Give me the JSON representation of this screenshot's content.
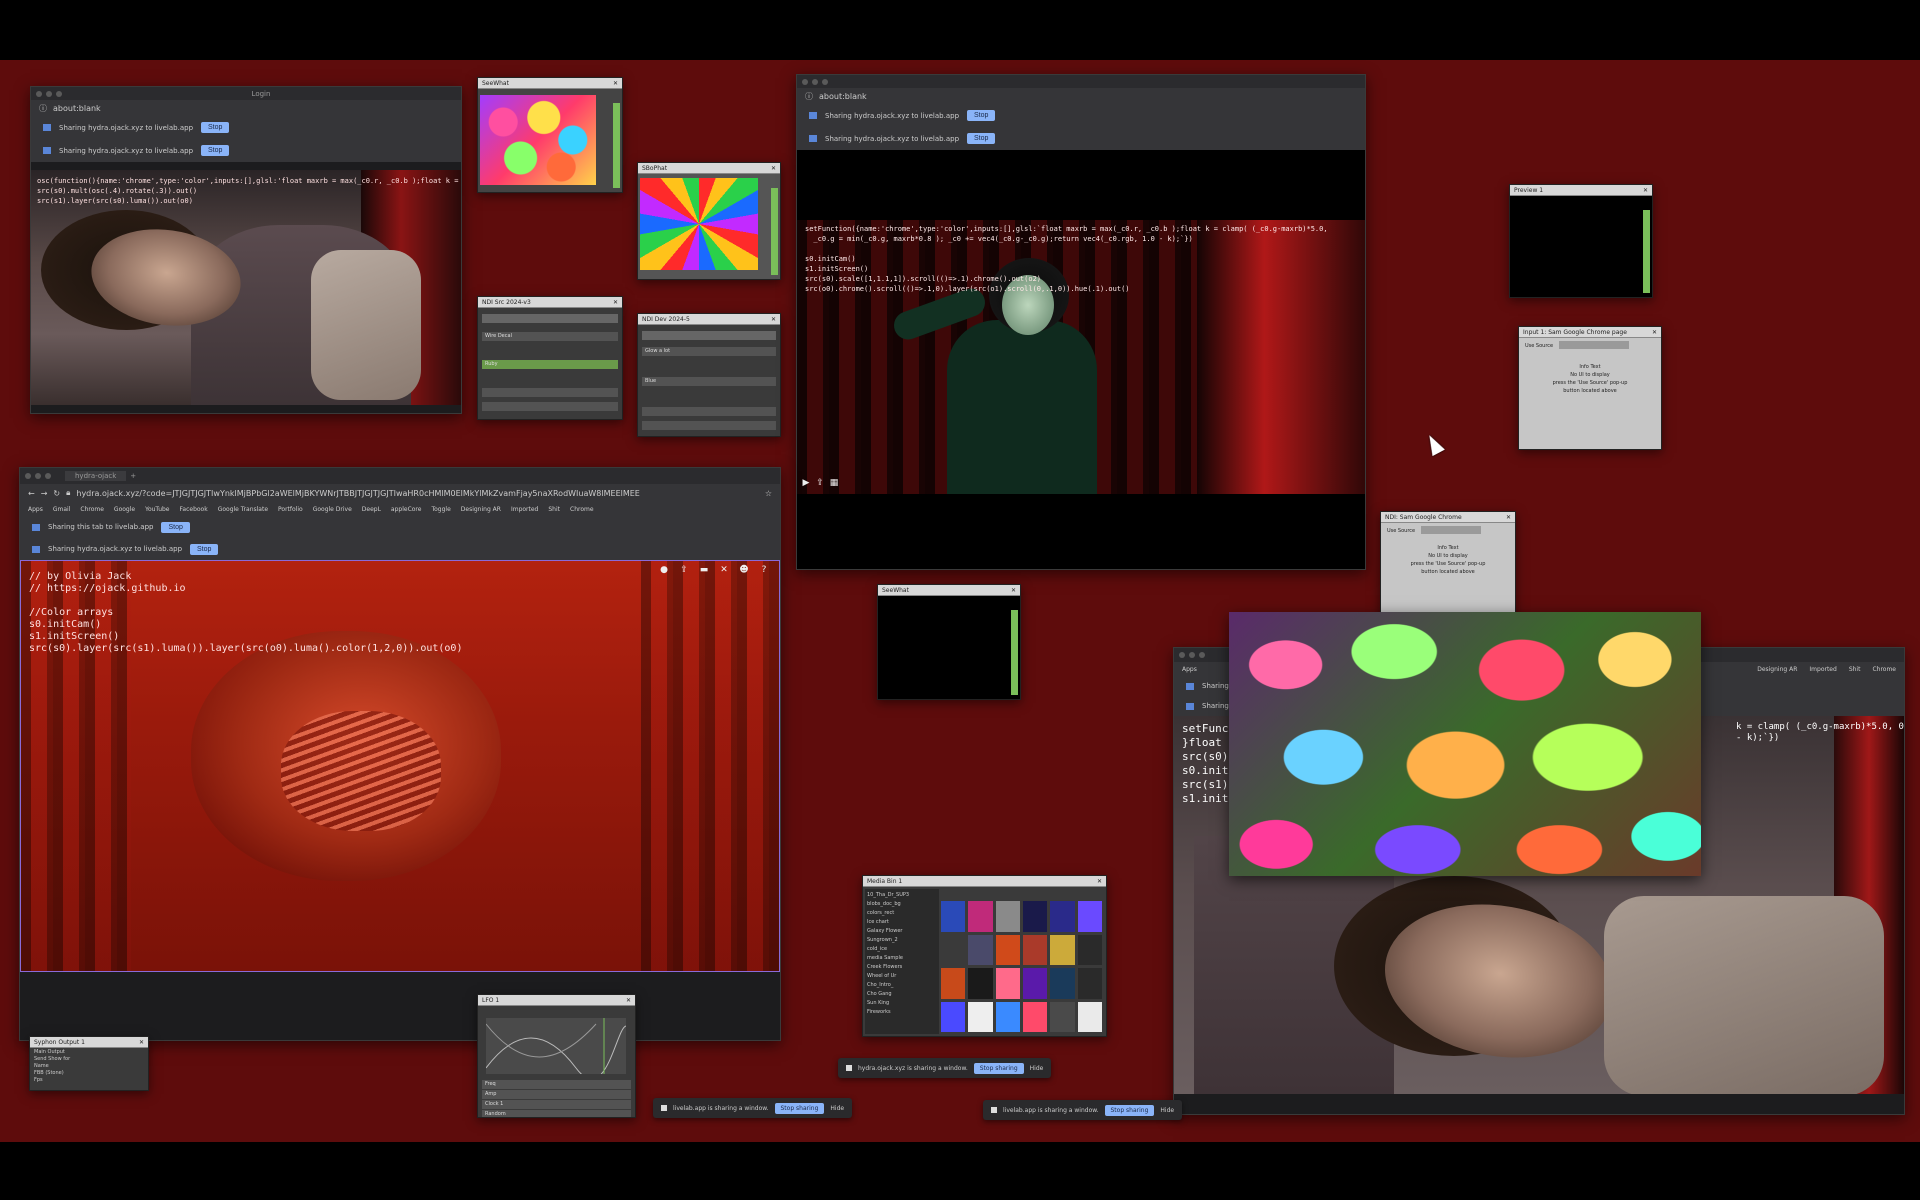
{
  "browser1": {
    "title": "Login",
    "url": "about:blank",
    "shares": [
      {
        "text": "Sharing hydra.ojack.xyz to livelab.app",
        "btn": "Stop"
      },
      {
        "text": "Sharing hydra.ojack.xyz to livelab.app",
        "btn": "Stop"
      }
    ],
    "code": "osc(function(){name:'chrome',type:'color',inputs:[],glsl:'float maxrb = max(_c0.r, _c0.b );float k = clamp(\nsrc(s0).mult(osc(.4).rotate(.3)).out()\nsrc(s1).layer(src(s0).luma()).out(o0)"
  },
  "td_bouldery": {
    "title": "SeeWhat"
  },
  "td_spiral": {
    "title": "SBoPhat"
  },
  "td_trackA": {
    "title": "NDI Src 2024-v3",
    "row1": "Wire Decal",
    "row2": "Ruby"
  },
  "td_trackB": {
    "title": "NDI Dev 2024-5",
    "row1": "Glow a lot",
    "row2": "Blue"
  },
  "browser2": {
    "url": "about:blank",
    "shares": [
      {
        "text": "Sharing hydra.ojack.xyz to livelab.app",
        "btn": "Stop"
      },
      {
        "text": "Sharing hydra.ojack.xyz to livelab.app",
        "btn": "Stop"
      }
    ],
    "code": "setFunction({name:'chrome',type:'color',inputs:[],glsl:`float maxrb = max(_c0.r, _c0.b );float k = clamp( (_c0.g-maxrb)*5.0,\n  _c0.g = min(_c0.g, maxrb*0.8 ); _c0 += vec4(_c0.g-_c0.g);return vec4(_c0.rgb, 1.0 - k);`})\n\ns0.initCam()\ns1.initScreen()\nsrc(s0).scale([1,1.1,1]).scroll(()=>.1).chrome().out(o2)\nsrc(o0).chrome().scroll(()=>.1,0).layer(src(o1).scroll(0,.1,0)).hue(.1).out()"
  },
  "browser3": {
    "tab": "hydra-ojack",
    "url": "hydra.ojack.xyz/?code=JTJGJTJGJTIwYnklMjBPbGl2aWElMjBKYWNrJTBBJTJGJTJGJTIwaHR0cHMlM0ElMkYlMkZvamFjay5naXRodWIuaW8lMEElMEE",
    "bookmarks": [
      "Apps",
      "Gmail",
      "Chrome",
      "Google",
      "YouTube",
      "Facebook",
      "Google Translate",
      "Portfolio",
      "Google Drive",
      "DeepL",
      "appleCore",
      "Toggle",
      "Designing AR",
      "Imported",
      "Shit",
      "Chrome"
    ],
    "shares": [
      {
        "text": "Sharing this tab to livelab.app",
        "btn": "Stop"
      },
      {
        "text": "Sharing hydra.ojack.xyz to livelab.app",
        "btn": "Stop"
      }
    ],
    "code": "// by Olivia Jack\n// https://ojack.github.io\n\n//Color arrays\ns0.initCam()\ns1.initScreen()\nsrc(s0).layer(src(s1).luma()).layer(src(o0).luma().color(1,2,0)).out(o0)"
  },
  "td_preview1": {
    "title": "Preview 1"
  },
  "td_panel1": {
    "title": "Input 1: Sam Google Chrome page",
    "field": "Use Source",
    "lines": [
      "Info Text",
      "No UI to display",
      "press the 'Use Source' pop-up",
      "button located above"
    ]
  },
  "td_panel2": {
    "title": "NDI: Sam Google Chrome",
    "field": "Use Source",
    "lines": [
      "Info Text",
      "No UI to display",
      "press the 'Use Source' pop-up",
      "button located above"
    ]
  },
  "td_black": {
    "title": "SeeWhat"
  },
  "td_media": {
    "title": "Media Bin 1",
    "items": [
      "10_Tha_Dr_SUP3",
      "blobs_doc_bg",
      "colors_rect",
      "Ice chart",
      "Galaxy Flower",
      "Sungrown_2",
      "cold_ice",
      "media Sample",
      "Creek Flowers",
      "Wheel of Ur",
      "Cho_Intro_",
      "Cho Gang",
      "Sun King",
      "Fireworks"
    ]
  },
  "td_lfo": {
    "title": "LFO 1",
    "rows": [
      "Freq",
      "Amp",
      "Clock 1",
      "Random"
    ]
  },
  "td_syphon": {
    "title": "Syphon Output 1",
    "rows": [
      "Main Output",
      "Send Show for",
      "Name",
      "FBB (Stone)",
      "Fps"
    ]
  },
  "browser4": {
    "bookmarks": [
      "Apps",
      "Designing AR",
      "Imported",
      "Shit",
      "Chrome"
    ],
    "shares": [
      "Sharing",
      "Sharing"
    ],
    "code": "setFuncti\n}float k\nsrc(s0).s\ns0.initCa\nsrc(s1).l\ns1.initSc",
    "code_right": "k = clamp( (_c0.g-maxrb)*5.0, 0.0\n- k);`})"
  },
  "share_pills": [
    {
      "text": "hydra.ojack.xyz is sharing a window.",
      "btn": "Stop sharing",
      "hide": "Hide"
    },
    {
      "text": "livelab.app is sharing a window.",
      "btn": "Stop sharing",
      "hide": "Hide"
    },
    {
      "text": "livelab.app is sharing a window.",
      "btn": "Stop sharing",
      "hide": "Hide"
    }
  ],
  "colors": {
    "desktop": "#5e0c0c",
    "chrome_dark": "#1c1c1e",
    "stop_button": "#8ab4f8",
    "td_green": "#7bbf5a"
  }
}
